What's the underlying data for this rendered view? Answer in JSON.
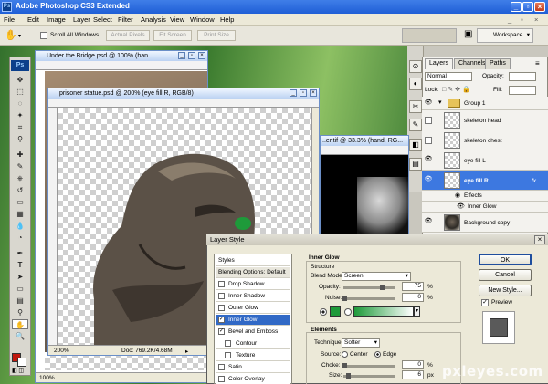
{
  "app": {
    "title": "Adobe Photoshop CS3 Extended",
    "logo": "Ps"
  },
  "menu": [
    "File",
    "Edit",
    "Image",
    "Layer",
    "Select",
    "Filter",
    "Analysis",
    "View",
    "Window",
    "Help"
  ],
  "options_bar": {
    "scroll_all_windows": "Scroll All Windows",
    "actual_pixels": "Actual Pixels",
    "fit_screen": "Fit Screen",
    "print_size": "Print Size",
    "workspace": "Workspace"
  },
  "documents": {
    "bridge": {
      "title": "Under the Bridge.psd @ 100% (han...",
      "zoom": "100%"
    },
    "statue": {
      "title": "prisoner statue.psd @ 200% (eye fill R, RGB/8)",
      "zoom": "200%",
      "doc_size": "Doc: 769.2K/4.68M"
    },
    "hand": {
      "title": "..er.tif @ 33.3% (hand, RG..."
    }
  },
  "layers_panel": {
    "tabs": [
      "Layers",
      "Channels",
      "Paths"
    ],
    "blend_mode": "Normal",
    "opacity_label": "Opacity:",
    "lock_label": "Lock:",
    "fill_label": "Fill:",
    "layers": [
      {
        "name": "Group 1",
        "type": "group"
      },
      {
        "name": "skeleton head",
        "type": "layer"
      },
      {
        "name": "skeleton chest",
        "type": "layer"
      },
      {
        "name": "eye fill L",
        "type": "layer"
      },
      {
        "name": "eye fill R",
        "type": "layer",
        "selected": true,
        "fx": "fx"
      },
      {
        "name": "Effects",
        "type": "effects"
      },
      {
        "name": "Inner Glow",
        "type": "effect"
      },
      {
        "name": "Background copy",
        "type": "layer"
      }
    ]
  },
  "layer_style": {
    "title": "Layer Style",
    "styles_header": "Styles",
    "blending_options": "Blending Options: Default",
    "styles": [
      {
        "label": "Drop Shadow",
        "checked": false
      },
      {
        "label": "Inner Shadow",
        "checked": false
      },
      {
        "label": "Outer Glow",
        "checked": false
      },
      {
        "label": "Inner Glow",
        "checked": true,
        "highlighted": true
      },
      {
        "label": "Bevel and Emboss",
        "checked": true
      },
      {
        "label": "Contour",
        "checked": false,
        "indent": true
      },
      {
        "label": "Texture",
        "checked": false,
        "indent": true
      },
      {
        "label": "Satin",
        "checked": false
      },
      {
        "label": "Color Overlay",
        "checked": false
      }
    ],
    "section_title": "Inner Glow",
    "structure_label": "Structure",
    "blend_mode_label": "Blend Mode:",
    "blend_mode_value": "Screen",
    "opacity_label": "Opacity:",
    "opacity_value": "75",
    "noise_label": "Noise:",
    "noise_value": "0",
    "percent": "%",
    "elements_label": "Elements",
    "technique_label": "Technique:",
    "technique_value": "Softer",
    "source_label": "Source:",
    "source_center": "Center",
    "source_edge": "Edge",
    "choke_label": "Choke:",
    "choke_value": "0",
    "size_label": "Size:",
    "size_value": "6",
    "px": "px",
    "glow_color": "#1e9a3a",
    "buttons": {
      "ok": "OK",
      "cancel": "Cancel",
      "new_style": "New Style...",
      "preview": "Preview"
    },
    "opacity_level": 0.75,
    "noise_level": 0.0
  },
  "watermark": "pxleyes.com"
}
